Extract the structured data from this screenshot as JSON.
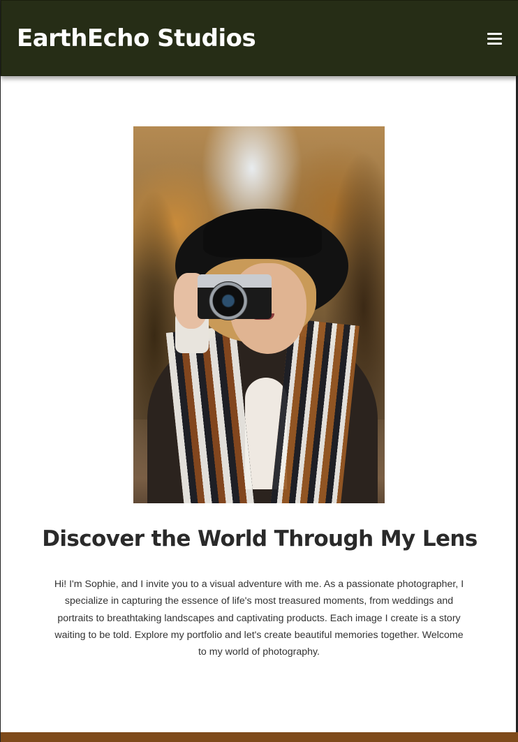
{
  "header": {
    "brand": "EarthEcho Studios",
    "menu_icon": "hamburger-menu-icon",
    "background": "#262d16"
  },
  "hero": {
    "image_subject": "Woman in black hat holding a film camera to her eye in an autumn forest",
    "heading": "Discover the World Through My Lens",
    "intro": "Hi! I'm Sophie, and I invite you to a visual adventure with me. As a passionate photographer, I specialize in capturing the essence of life's most treasured moments, from weddings and portraits to breathtaking landscapes and captivating products. Each image I create is a story waiting to be told. Explore my portfolio and let's create beautiful memories together. Welcome to my world of photography."
  },
  "footer": {
    "accent": "#7e4a1a"
  }
}
